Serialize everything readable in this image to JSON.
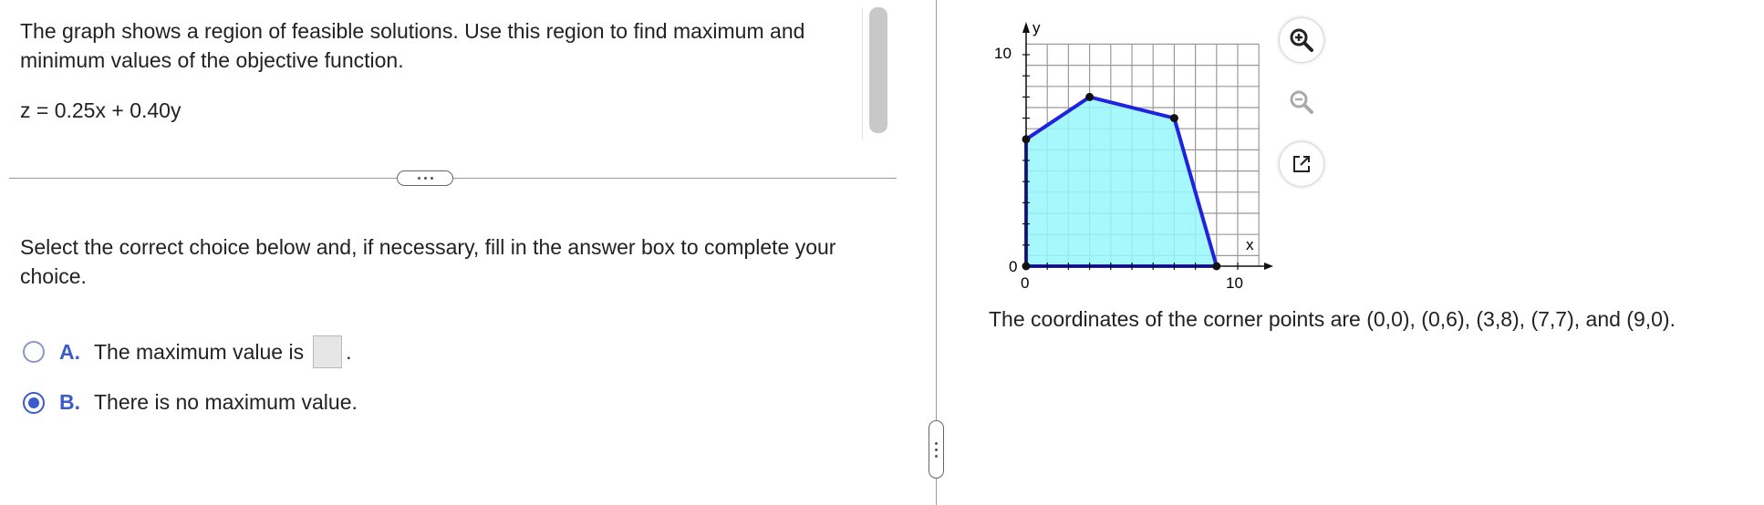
{
  "problem": {
    "text": "The graph shows a region of feasible solutions. Use this region to find maximum and minimum values of the objective function.",
    "equation": "z = 0.25x + 0.40y"
  },
  "instruction": "Select the correct choice below and, if necessary, fill in the answer box to complete your choice.",
  "choices": [
    {
      "letter": "A.",
      "text": "The maximum value is",
      "after_box": ".",
      "selected": false
    },
    {
      "letter": "B.",
      "text": "There is no maximum value.",
      "selected": true
    }
  ],
  "graph": {
    "x_axis_label": "x",
    "y_axis_label": "y",
    "x_tick_0": "0",
    "x_tick_10": "10",
    "y_tick_0": "0",
    "y_tick_10": "10",
    "x_range": [
      0,
      10
    ],
    "y_range": [
      0,
      10
    ],
    "grid": true,
    "corner_points": [
      [
        0,
        0
      ],
      [
        0,
        6
      ],
      [
        3,
        8
      ],
      [
        7,
        7
      ],
      [
        9,
        0
      ]
    ],
    "fill_color": "#96f7fc",
    "boundary_color": "#1f22e0"
  },
  "tools": {
    "zoom_in_icon": "zoom-in-icon",
    "zoom_out_icon": "zoom-out-icon",
    "popout_icon": "popout-icon"
  },
  "corner_text": "The coordinates of the corner points are (0,0), (0,6), (3,8), (7,7), and (9,0).",
  "colors": {
    "accent": "#3b5bc9"
  }
}
